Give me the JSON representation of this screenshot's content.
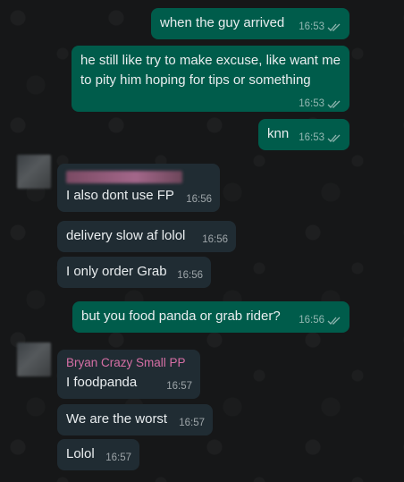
{
  "messages": [
    {
      "text": "when the guy arrived",
      "time": "16:53",
      "dir": "out"
    },
    {
      "text": "he still like try to make excuse, like want me to pity him hoping for tips or something",
      "time": "16:53",
      "dir": "out"
    },
    {
      "text": "knn",
      "time": "16:53",
      "dir": "out"
    },
    {
      "text": "I also dont use FP",
      "time": "16:56",
      "dir": "in"
    },
    {
      "text": "delivery slow af lolol",
      "time": "16:56",
      "dir": "in"
    },
    {
      "text": "I only order Grab",
      "time": "16:56",
      "dir": "in"
    },
    {
      "text": "but you food panda or grab rider?",
      "time": "16:56",
      "dir": "out"
    },
    {
      "sender": "Bryan Crazy Small PP",
      "text": "I foodpanda",
      "time": "16:57",
      "dir": "in"
    },
    {
      "text": "We are the worst",
      "time": "16:57",
      "dir": "in"
    },
    {
      "text": "Lolol",
      "time": "16:57",
      "dir": "in"
    }
  ],
  "colors": {
    "outgoing_bubble": "#005c4b",
    "incoming_bubble": "#202c33",
    "sender_name": "#d66fa5",
    "background": "#161718"
  }
}
